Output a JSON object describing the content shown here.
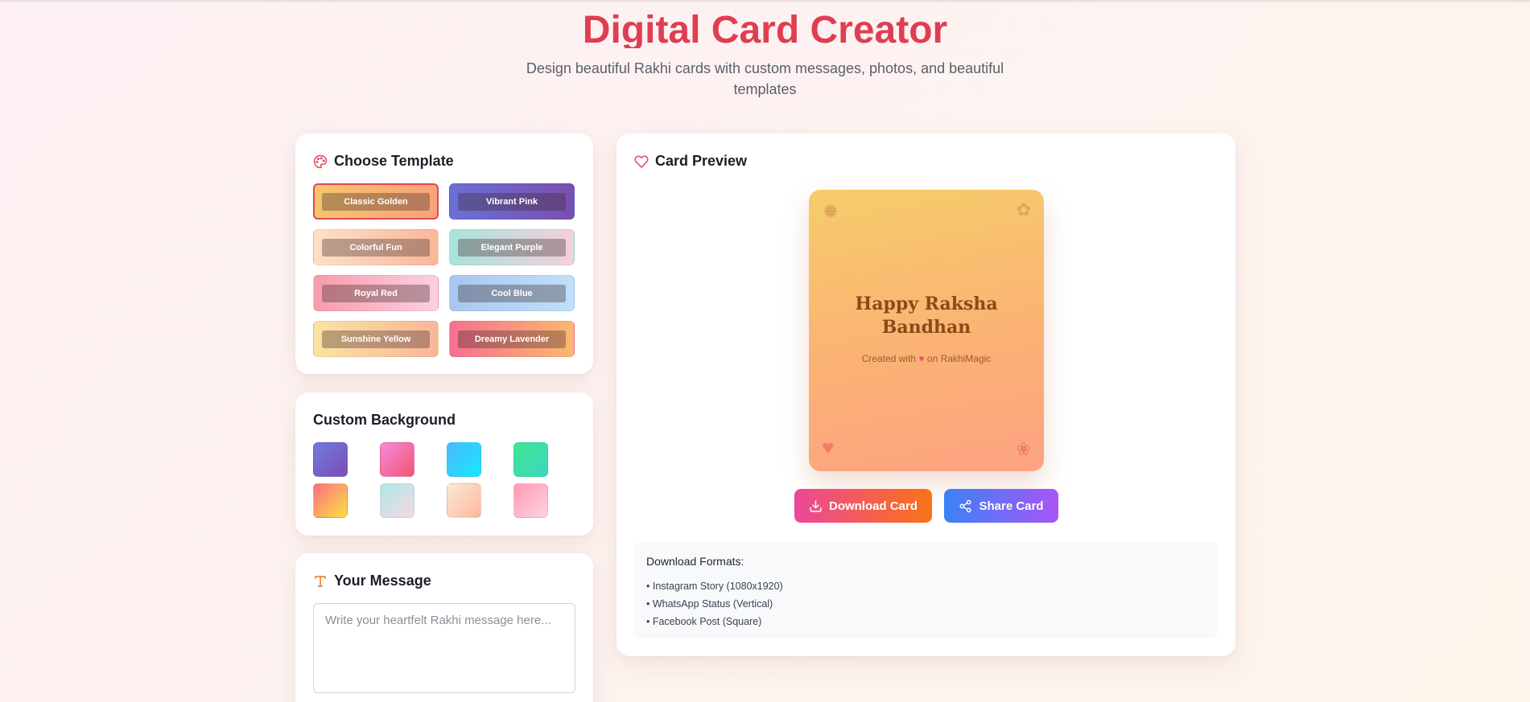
{
  "hero": {
    "title": "Digital Card Creator",
    "subtitle": "Design beautiful Rakhi cards with custom messages, photos, and beautiful templates"
  },
  "templates": {
    "title": "Choose Template",
    "items": [
      {
        "label": "Classic Golden",
        "gradient": [
          "#f6c56a",
          "#f9a27a"
        ],
        "selected": true
      },
      {
        "label": "Vibrant Pink",
        "gradient": [
          "#6a6fd6",
          "#7a4fb0"
        ],
        "selected": false
      },
      {
        "label": "Colorful Fun",
        "gradient": [
          "#fde0c8",
          "#f9b69a"
        ],
        "selected": false
      },
      {
        "label": "Elegant Purple",
        "gradient": [
          "#a7e3dc",
          "#f4cfdc"
        ],
        "selected": false
      },
      {
        "label": "Royal Red",
        "gradient": [
          "#f79cab",
          "#fccfe0"
        ],
        "selected": false
      },
      {
        "label": "Cool Blue",
        "gradient": [
          "#a7c7f0",
          "#bfe0f9"
        ],
        "selected": false
      },
      {
        "label": "Sunshine Yellow",
        "gradient": [
          "#fbe3a1",
          "#f9b599"
        ],
        "selected": false
      },
      {
        "label": "Dreamy Lavender",
        "gradient": [
          "#f5708f",
          "#fbb86f"
        ],
        "selected": false
      }
    ]
  },
  "background": {
    "title": "Custom Background",
    "swatches": [
      [
        "#6f7be0",
        "#7a4eb0"
      ],
      [
        "#f38bdf",
        "#f2556d"
      ],
      [
        "#4fb6fa",
        "#14eaff"
      ],
      [
        "#43e48e",
        "#3ad8c0"
      ],
      [
        "#fa6f81",
        "#fce143"
      ],
      [
        "#a8ebe6",
        "#fad6e4"
      ],
      [
        "#fde9d6",
        "#fbb79c"
      ],
      [
        "#ff9ab0",
        "#fdd3e0"
      ]
    ]
  },
  "message": {
    "title": "Your Message",
    "placeholder": "Write your heartfelt Rakhi message here..."
  },
  "preview": {
    "title": "Card Preview",
    "greeting_line1": "Happy Raksha",
    "greeting_line2": "Bandhan",
    "credit_prefix": "Created with",
    "credit_suffix": "on RakhiMagic",
    "download_label": "Download Card",
    "share_label": "Share Card",
    "formats_title": "Download Formats:",
    "formats": [
      "• Instagram Story (1080x1920)",
      "• WhatsApp Status (Vertical)",
      "• Facebook Post (Square)"
    ]
  }
}
